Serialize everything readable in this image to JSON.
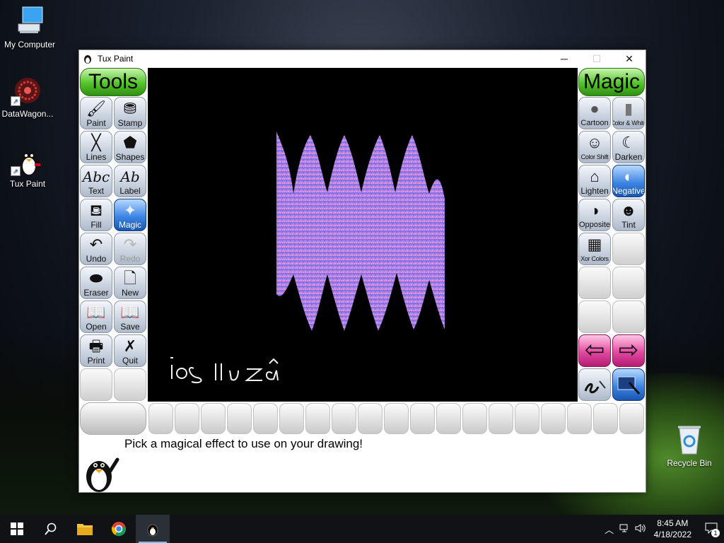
{
  "desktop": {
    "icons": [
      {
        "label": "My Computer"
      },
      {
        "label": "DataWagon..."
      },
      {
        "label": "Tux Paint"
      },
      {
        "label": "Recycle Bin"
      }
    ]
  },
  "window": {
    "title": "Tux Paint",
    "controls": {
      "minimize": "─",
      "maximize": "☐",
      "close": "✕"
    }
  },
  "tools": {
    "header": "Tools",
    "items": [
      {
        "label": "Paint",
        "glyph": "🖌"
      },
      {
        "label": "Stamp",
        "glyph": "⛃"
      },
      {
        "label": "Lines",
        "glyph": "╳"
      },
      {
        "label": "Shapes",
        "glyph": "⬟"
      },
      {
        "label": "Text",
        "glyph": "Abc"
      },
      {
        "label": "Label",
        "glyph": "Ab"
      },
      {
        "label": "Fill",
        "glyph": "⛾"
      },
      {
        "label": "Magic",
        "glyph": "✦"
      },
      {
        "label": "Undo",
        "glyph": "↶"
      },
      {
        "label": "Redo",
        "glyph": "↷"
      },
      {
        "label": "Eraser",
        "glyph": "⬬"
      },
      {
        "label": "New",
        "glyph": "🗋"
      },
      {
        "label": "Open",
        "glyph": "📖"
      },
      {
        "label": "Save",
        "glyph": "📖"
      },
      {
        "label": "Print",
        "glyph": "🖶"
      },
      {
        "label": "Quit",
        "glyph": "✗"
      }
    ],
    "selected": "Magic"
  },
  "magic": {
    "header": "Magic",
    "items": [
      {
        "label": "Cartoon",
        "glyph": "●"
      },
      {
        "label": "Color & White",
        "glyph": "▮"
      },
      {
        "label": "Color Shift",
        "glyph": "☺"
      },
      {
        "label": "Darken",
        "glyph": "☾"
      },
      {
        "label": "Lighten",
        "glyph": "⌂"
      },
      {
        "label": "Negative",
        "glyph": "◐"
      },
      {
        "label": "Opposite",
        "glyph": "◑"
      },
      {
        "label": "Tint",
        "glyph": "☻"
      },
      {
        "label": "Xor Colors",
        "glyph": "▦"
      }
    ],
    "selected": "Negative",
    "nav": {
      "prev": "⇦",
      "next": "⇨"
    }
  },
  "canvas": {
    "handwriting": "ios luza"
  },
  "message": {
    "text": "Pick a magical effect to use on your drawing!"
  },
  "taskbar": {
    "time": "8:45 AM",
    "date": "4/18/2022",
    "notification_count": "1"
  },
  "colors": {
    "selected_blue": "#3f86e4",
    "header_green": "#54c42a",
    "nav_pink": "#e24aa0"
  }
}
